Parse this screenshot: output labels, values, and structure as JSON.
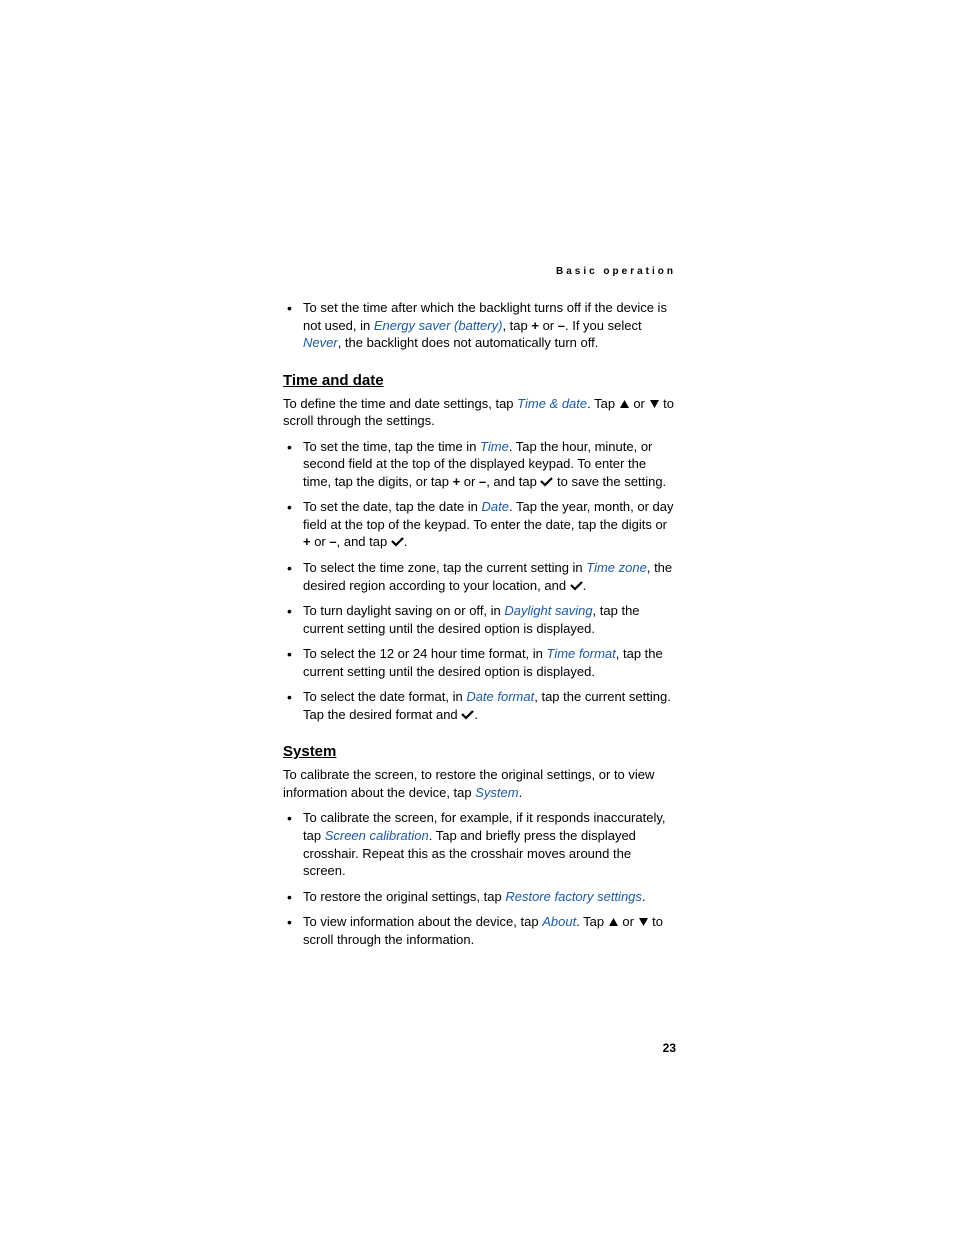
{
  "header": "Basic operation",
  "page_number": "23",
  "backlight_bullet": {
    "pre": "To set the time after which the backlight turns off if the device is not used, in ",
    "link1": "Energy saver (battery)",
    "mid1": ", tap ",
    "plus": "+",
    "mid2": " or ",
    "minus": "–",
    "mid3": ". If you select ",
    "link2": "Never",
    "post": ", the backlight does not automatically turn off."
  },
  "time_and_date": {
    "heading": "Time and date",
    "intro_pre": "To define the time and date settings, tap ",
    "intro_link": "Time & date",
    "intro_mid1": ". Tap ",
    "intro_mid2": " or ",
    "intro_post": " to scroll through the settings.",
    "bullets": [
      {
        "pre": "To set the time, tap the time in ",
        "link": "Time",
        "mid1": ". Tap the hour, minute, or second field at the top of the displayed keypad. To enter the time, tap the digits, or tap ",
        "plus": "+",
        "mid2": " or ",
        "minus": "–",
        "mid3": ", and tap ",
        "post": " to save the setting."
      },
      {
        "pre": "To set the date, tap the date in ",
        "link": "Date",
        "mid1": ". Tap the year, month, or day field at the top of the keypad. To enter the date, tap the digits or ",
        "plus": "+",
        "mid2": " or ",
        "minus": "–",
        "mid3": ", and tap ",
        "post": "."
      },
      {
        "pre": "To select the time zone, tap the current setting in ",
        "link": "Time zone",
        "mid": ", the desired region according to your location, and ",
        "post": "."
      },
      {
        "pre": "To turn daylight saving on or off, in ",
        "link": "Daylight saving",
        "post": ", tap the current setting until the desired option is displayed."
      },
      {
        "pre": "To select the 12 or 24 hour time format, in ",
        "link": "Time format",
        "post": ", tap the current setting until the desired option is displayed."
      },
      {
        "pre": "To select the date format, in ",
        "link": "Date format",
        "mid": ", tap the current setting. Tap the desired format and ",
        "post": "."
      }
    ]
  },
  "system": {
    "heading": "System",
    "intro_pre": "To calibrate the screen, to restore the original settings, or to view information about the device, tap ",
    "intro_link": "System",
    "intro_post": ".",
    "bullets": [
      {
        "pre": "To calibrate the screen, for example, if it responds inaccurately, tap ",
        "link": "Screen calibration",
        "post": ". Tap and briefly press the displayed crosshair. Repeat this as the crosshair moves around the screen."
      },
      {
        "pre": "To restore the original settings, tap ",
        "link": "Restore factory settings",
        "post": "."
      },
      {
        "pre": "To view information about the device, tap ",
        "link": "About",
        "mid1": ". Tap ",
        "mid2": " or ",
        "post": " to scroll through the information."
      }
    ]
  }
}
